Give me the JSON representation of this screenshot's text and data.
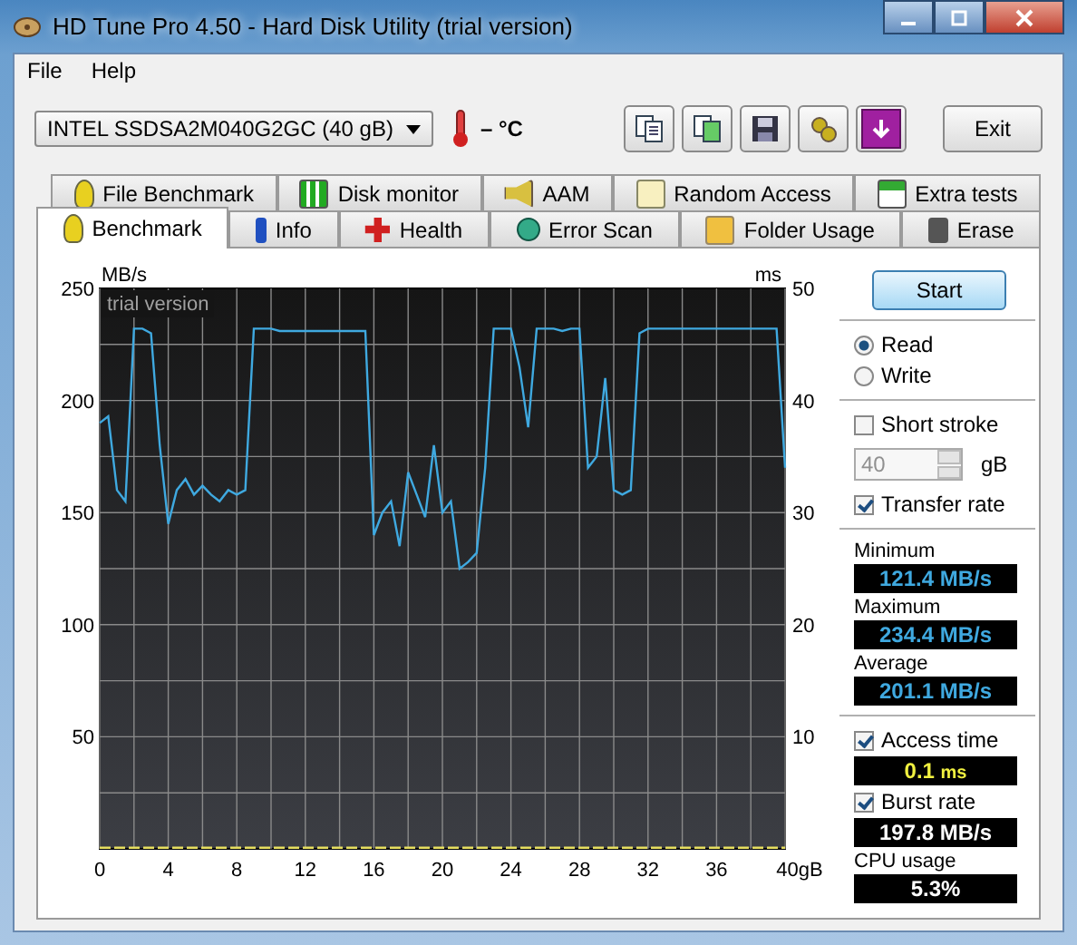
{
  "window": {
    "title": "HD Tune Pro 4.50 - Hard Disk Utility (trial version)"
  },
  "menu": [
    {
      "label": "File"
    },
    {
      "label": "Help"
    }
  ],
  "toolbar": {
    "drive": "INTEL SSDSA2M040G2GC (40 gB)",
    "temperature": "– °C",
    "exit_button": "Exit"
  },
  "tabs_back": [
    {
      "label": "File Benchmark",
      "selected": false
    },
    {
      "label": "Disk monitor",
      "selected": false
    },
    {
      "label": "AAM",
      "selected": false
    },
    {
      "label": "Random Access",
      "selected": false
    },
    {
      "label": "Extra tests",
      "selected": false
    }
  ],
  "tabs_front": [
    {
      "label": "Benchmark",
      "selected": true
    },
    {
      "label": "Info",
      "selected": false
    },
    {
      "label": "Health",
      "selected": false
    },
    {
      "label": "Error Scan",
      "selected": false
    },
    {
      "label": "Folder Usage",
      "selected": false
    },
    {
      "label": "Erase",
      "selected": false
    }
  ],
  "benchmark": {
    "chart_watermark": "trial version",
    "chart_data": {
      "type": "line",
      "grid": true,
      "ylabel": "MB/s",
      "y2label": "ms",
      "xlim": [
        0,
        40
      ],
      "ylim": [
        0,
        250
      ],
      "y2lim": [
        0,
        50
      ],
      "xticks": [
        0,
        4,
        8,
        12,
        16,
        20,
        24,
        28,
        32,
        36,
        {
          "value": 40,
          "label": "40gB"
        }
      ],
      "yticks": [
        50,
        100,
        150,
        200,
        250
      ],
      "y2ticks": [
        10,
        20,
        30,
        40,
        50
      ],
      "x": [
        0,
        0.5,
        1,
        1.5,
        2,
        2.5,
        3,
        3.5,
        4,
        4.5,
        5,
        5.5,
        6,
        6.5,
        7,
        7.5,
        8,
        8.5,
        9,
        9.5,
        10,
        10.5,
        11,
        11.5,
        12,
        12.5,
        13,
        13.5,
        14,
        14.5,
        15,
        15.5,
        16,
        16.5,
        17,
        17.5,
        18,
        18.5,
        19,
        19.5,
        20,
        20.5,
        21,
        21.5,
        22,
        22.5,
        23,
        23.5,
        24,
        24.5,
        25,
        25.5,
        26,
        26.5,
        27,
        27.5,
        28,
        28.5,
        29,
        29.5,
        30,
        30.5,
        31,
        31.5,
        32,
        32.5,
        33,
        33.5,
        34,
        34.5,
        35,
        35.5,
        36,
        36.5,
        37,
        37.5,
        38,
        38.5,
        39,
        39.5,
        40
      ],
      "series": [
        {
          "color": "#3fa9e0",
          "values": [
            190,
            193,
            160,
            155,
            232,
            232,
            230,
            180,
            145,
            160,
            165,
            158,
            162,
            158,
            155,
            160,
            158,
            160,
            232,
            232,
            232,
            231,
            231,
            231,
            231,
            231,
            231,
            231,
            231,
            231,
            231,
            231,
            140,
            150,
            155,
            135,
            168,
            158,
            148,
            180,
            150,
            155,
            125,
            128,
            132,
            170,
            232,
            232,
            232,
            215,
            188,
            232,
            232,
            232,
            231,
            232,
            232,
            170,
            175,
            210,
            160,
            158,
            160,
            230,
            232,
            232,
            232,
            232,
            232,
            232,
            232,
            232,
            232,
            232,
            232,
            232,
            232,
            232,
            232,
            232,
            170
          ]
        },
        {
          "color": "#e8e060",
          "axis": "y2",
          "line_style": "dashed",
          "values": [
            0.1,
            0.1,
            0.1,
            0.1,
            0.1,
            0.1,
            0.1,
            0.1,
            0.1,
            0.1,
            0.1,
            0.1,
            0.1,
            0.1,
            0.1,
            0.1,
            0.1,
            0.1,
            0.1,
            0.1,
            0.1,
            0.1,
            0.1,
            0.1,
            0.1,
            0.1,
            0.1,
            0.1,
            0.1,
            0.1,
            0.1,
            0.1,
            0.1,
            0.1,
            0.1,
            0.1,
            0.1,
            0.1,
            0.1,
            0.1,
            0.1,
            0.1,
            0.1,
            0.1,
            0.1,
            0.1,
            0.1,
            0.1,
            0.1,
            0.1,
            0.1,
            0.1,
            0.1,
            0.1,
            0.1,
            0.1,
            0.1,
            0.1,
            0.1,
            0.1,
            0.1,
            0.1,
            0.1,
            0.1,
            0.1,
            0.1,
            0.1,
            0.1,
            0.1,
            0.1,
            0.1,
            0.1,
            0.1,
            0.1,
            0.1,
            0.1,
            0.1,
            0.1,
            0.1,
            0.1,
            0.1
          ]
        }
      ]
    },
    "start_button": "Start",
    "modes": [
      {
        "label": "Read",
        "selected": true
      },
      {
        "label": "Write",
        "selected": false
      }
    ],
    "short_stroke": {
      "label": "Short stroke",
      "checked": false
    },
    "stroke_size": {
      "value": "40",
      "unit": "gB",
      "disabled": true
    },
    "transfer_rate": {
      "label": "Transfer rate",
      "checked": true
    },
    "transfer_readouts": [
      {
        "label": "Minimum",
        "value": "121.4 MB/s"
      },
      {
        "label": "Maximum",
        "value": "234.4 MB/s"
      },
      {
        "label": "Average",
        "value": "201.1 MB/s"
      }
    ],
    "access_time": {
      "label": "Access time",
      "checked": true,
      "value": "0.1",
      "unit": "ms"
    },
    "burst_rate": {
      "label": "Burst rate",
      "checked": true,
      "value": "197.8 MB/s"
    },
    "cpu_usage": {
      "label": "CPU usage",
      "value": "5.3%"
    }
  }
}
